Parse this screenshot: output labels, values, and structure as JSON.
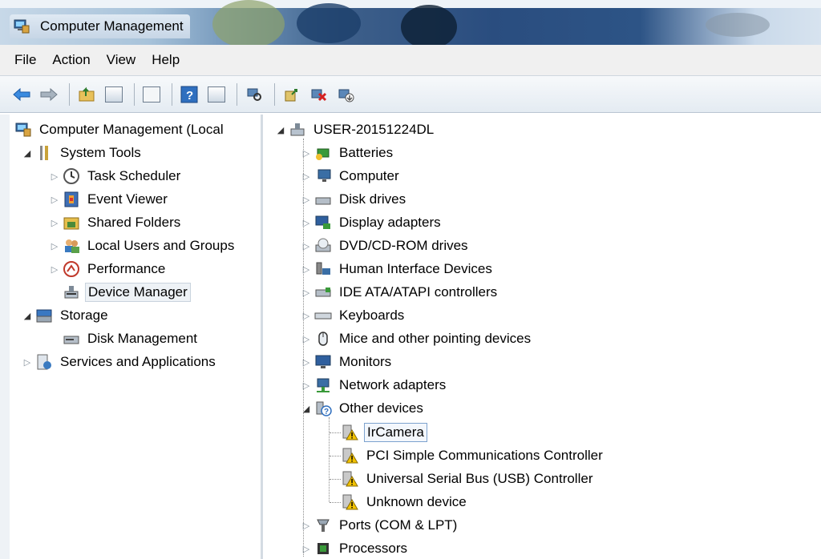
{
  "window": {
    "title": "Computer Management"
  },
  "menu": [
    "File",
    "Action",
    "View",
    "Help"
  ],
  "left_tree": {
    "root": "Computer Management (Local",
    "system_tools": "System Tools",
    "system_tools_children": [
      "Task Scheduler",
      "Event Viewer",
      "Shared Folders",
      "Local Users and Groups",
      "Performance",
      "Device Manager"
    ],
    "storage": "Storage",
    "storage_children": [
      "Disk Management"
    ],
    "services": "Services and Applications"
  },
  "device_tree": {
    "computer": "USER-20151224DL",
    "categories": [
      "Batteries",
      "Computer",
      "Disk drives",
      "Display adapters",
      "DVD/CD-ROM drives",
      "Human Interface Devices",
      "IDE ATA/ATAPI controllers",
      "Keyboards",
      "Mice and other pointing devices",
      "Monitors",
      "Network adapters",
      "Other devices"
    ],
    "other_devices": [
      "IrCamera",
      "PCI Simple Communications Controller",
      "Universal Serial Bus (USB) Controller",
      "Unknown device"
    ],
    "after": [
      "Ports (COM & LPT)",
      "Processors"
    ]
  },
  "colors": {
    "warning": "#f2c200",
    "selection_border": "#7da2ce"
  }
}
